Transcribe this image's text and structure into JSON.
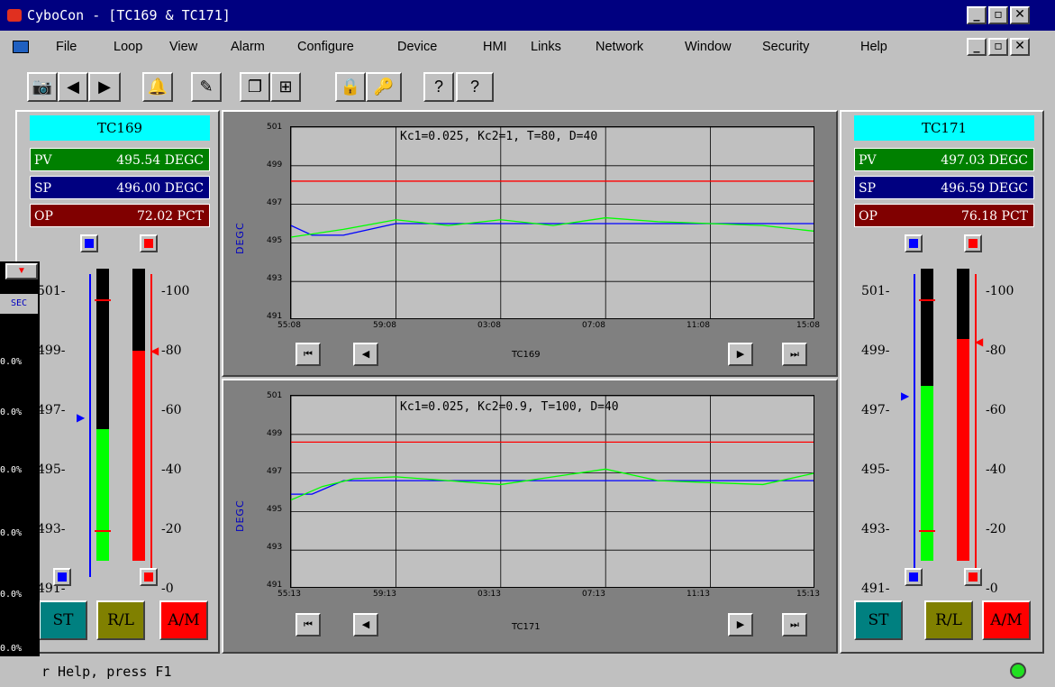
{
  "window": {
    "title": "CyboCon - [TC169 & TC171]",
    "controls": [
      "_",
      "▫",
      "✕"
    ],
    "mdi_controls": [
      "_",
      "▫",
      "✕"
    ]
  },
  "menu": [
    "File",
    "Loop",
    "View",
    "Alarm",
    "Configure",
    "Device",
    "HMI",
    "Links",
    "Network",
    "Window",
    "Security",
    "Help"
  ],
  "toolbar": [
    "camera",
    "back",
    "forward",
    "alarm-bell",
    "config",
    "window-cascade",
    "window-tile",
    "lock",
    "key",
    "help",
    "context-help"
  ],
  "left_panel": {
    "tag": "TC169",
    "pv_key": "PV",
    "pv": "495.54 DEGC",
    "sp_key": "SP",
    "sp": "496.00 DEGC",
    "op_key": "OP",
    "op": "72.02 PCT",
    "scale_left": [
      "501-",
      "499-",
      "497-",
      "495-",
      "493-",
      "491-"
    ],
    "scale_right": [
      "-100",
      "-80",
      "-60",
      "-40",
      "-20",
      "-0"
    ],
    "pv_level": 0.45,
    "op_level": 0.72,
    "modes": [
      "ST",
      "R/L",
      "A/M"
    ]
  },
  "right_panel": {
    "tag": "TC171",
    "pv_key": "PV",
    "pv": "497.03 DEGC",
    "sp_key": "SP",
    "sp": "496.59 DEGC",
    "op_key": "OP",
    "op": "76.18 PCT",
    "scale_left": [
      "501-",
      "499-",
      "497-",
      "495-",
      "493-",
      "491-"
    ],
    "scale_right": [
      "-100",
      "-80",
      "-60",
      "-40",
      "-20",
      "-0"
    ],
    "pv_level": 0.6,
    "op_level": 0.76,
    "modes": [
      "ST",
      "R/L",
      "A/M"
    ]
  },
  "trend_top": {
    "title": "Kc1=0.025, Kc2=1, T=80, D=40",
    "axis": "DEGC",
    "name": "TC169",
    "y_ticks": [
      "501",
      "499",
      "497",
      "495",
      "493",
      "491"
    ],
    "x_ticks": [
      "55:08",
      "59:08",
      "03:08",
      "07:08",
      "11:08",
      "15:08"
    ]
  },
  "trend_bottom": {
    "title": "Kc1=0.025, Kc2=0.9, T=100, D=40",
    "axis": "DEGC",
    "name": "TC171",
    "y_ticks": [
      "501",
      "499",
      "497",
      "495",
      "493",
      "491"
    ],
    "x_ticks": [
      "55:13",
      "59:13",
      "03:13",
      "07:13",
      "11:13",
      "15:13"
    ]
  },
  "nav": {
    "first": "⏮",
    "prev": "◀",
    "next": "▶",
    "last": "⏭"
  },
  "leftstrip": {
    "btn": "▼",
    "label": "SEC",
    "values": [
      "0.0%",
      "0.0%",
      "0.0%",
      "0.0%",
      "0.0%",
      "0.0%"
    ]
  },
  "status": {
    "text": "r Help, press F1"
  },
  "colors": {
    "pv": "#008000",
    "sp": "#000080",
    "op": "#800000",
    "tag": "#00ffff",
    "st": "#008080",
    "rl": "#808000",
    "am": "#ff0000",
    "trend_bg": "#808080"
  },
  "chart_data": [
    {
      "type": "line",
      "title": "Kc1=0.025, Kc2=1, T=80, D=40",
      "ylabel": "DEGC",
      "xlabel": "TC169",
      "categories": [
        "55:08",
        "59:08",
        "03:08",
        "07:08",
        "11:08",
        "15:08"
      ],
      "ylim": [
        491,
        501
      ],
      "series": [
        {
          "name": "",
          "color": "#ff0000",
          "x": [
            0,
            1,
            2,
            3,
            4,
            5
          ],
          "values": [
            498.2,
            498.2,
            498.2,
            498.2,
            498.2,
            498.2
          ]
        },
        {
          "name": "",
          "color": "#0000ff",
          "x": [
            0,
            0.2,
            0.5,
            1,
            2,
            3,
            4,
            5
          ],
          "values": [
            495.9,
            495.4,
            495.4,
            496.0,
            496.0,
            496.0,
            496.0,
            496.0
          ]
        },
        {
          "name": "",
          "color": "#00ff00",
          "x": [
            0,
            0.5,
            1,
            1.5,
            2,
            2.5,
            3,
            3.5,
            4,
            4.5,
            5
          ],
          "values": [
            495.3,
            495.7,
            496.2,
            495.9,
            496.2,
            495.9,
            496.3,
            496.1,
            496.0,
            495.9,
            495.6
          ]
        }
      ]
    },
    {
      "type": "line",
      "title": "Kc1=0.025, Kc2=0.9, T=100, D=40",
      "ylabel": "DEGC",
      "xlabel": "TC171",
      "categories": [
        "55:13",
        "59:13",
        "03:13",
        "07:13",
        "11:13",
        "15:13"
      ],
      "ylim": [
        491,
        501
      ],
      "series": [
        {
          "name": "",
          "color": "#ff0000",
          "x": [
            0,
            5
          ],
          "values": [
            498.6,
            498.6
          ]
        },
        {
          "name": "",
          "color": "#0000ff",
          "x": [
            0,
            0.2,
            0.5,
            1,
            5
          ],
          "values": [
            495.9,
            495.9,
            496.6,
            496.6,
            496.6
          ]
        },
        {
          "name": "",
          "color": "#00ff00",
          "x": [
            0,
            0.3,
            0.6,
            1,
            1.5,
            2,
            2.5,
            3,
            3.5,
            4,
            4.5,
            5
          ],
          "values": [
            495.6,
            496.3,
            496.7,
            496.8,
            496.6,
            496.4,
            496.8,
            497.2,
            496.6,
            496.5,
            496.4,
            497.0
          ]
        }
      ]
    }
  ]
}
